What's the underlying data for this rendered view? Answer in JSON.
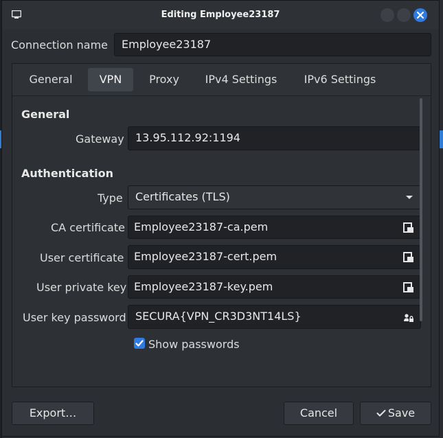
{
  "window": {
    "title": "Editing Employee23187"
  },
  "connection": {
    "label": "Connection name",
    "value": "Employee23187"
  },
  "tabs": [
    {
      "label": "General"
    },
    {
      "label": "VPN"
    },
    {
      "label": "Proxy"
    },
    {
      "label": "IPv4 Settings"
    },
    {
      "label": "IPv6 Settings"
    }
  ],
  "vpn": {
    "general_header": "General",
    "gateway_label": "Gateway",
    "gateway_value": "13.95.112.92:1194",
    "auth_header": "Authentication",
    "type_label": "Type",
    "type_value": "Certificates (TLS)",
    "ca_label": "CA certificate",
    "ca_value": "Employee23187-ca.pem",
    "user_cert_label": "User certificate",
    "user_cert_value": "Employee23187-cert.pem",
    "private_key_label": "User private key",
    "private_key_value": "Employee23187-key.pem",
    "key_password_label": "User key password",
    "key_password_value": "SECURA{VPN_CR3D3NT14LS}",
    "show_passwords_label": "Show passwords",
    "show_passwords_checked": true
  },
  "buttons": {
    "export": "Export…",
    "cancel": "Cancel",
    "save": "Save"
  },
  "icons": {
    "app": "app-window-icon",
    "file": "file-picker-icon",
    "password": "password-user-icon",
    "check": "checkmark-icon"
  },
  "colors": {
    "accent": "#2f7be0",
    "window_bg": "#2b2e33",
    "input_bg": "#202226"
  }
}
